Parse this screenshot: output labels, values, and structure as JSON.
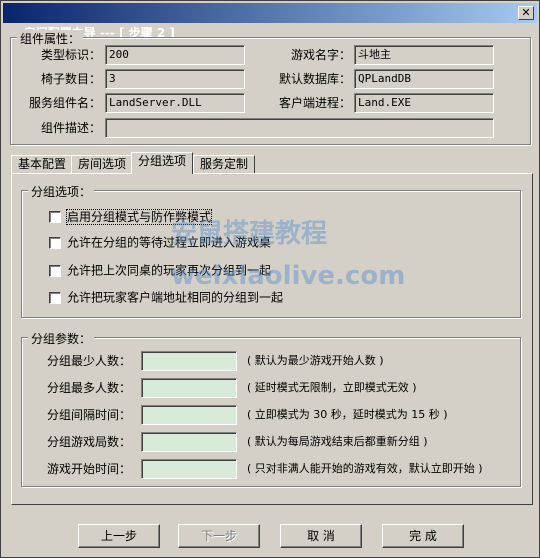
{
  "window": {
    "title": "房间配置向导 --- [ 步骤 2 ]",
    "close_glyph": "✕"
  },
  "component_group": {
    "title": "组件属性：",
    "fields": [
      {
        "label": "类型标识：",
        "value": "200"
      },
      {
        "label": "游戏名字：",
        "value": "斗地主"
      },
      {
        "label": "椅子数目：",
        "value": "3"
      },
      {
        "label": "默认数据库：",
        "value": "QPLandDB"
      },
      {
        "label": "服务组件名：",
        "value": "LandServer.DLL"
      },
      {
        "label": "客户端进程：",
        "value": "Land.EXE"
      },
      {
        "label": "组件描述：",
        "value": ""
      }
    ]
  },
  "tabs": [
    {
      "label": "基本配置"
    },
    {
      "label": "房间选项"
    },
    {
      "label": "分组选项"
    },
    {
      "label": "服务定制"
    }
  ],
  "group_options": {
    "title": "分组选项：",
    "items": [
      {
        "label": "启用分组模式与防作弊模式"
      },
      {
        "label": "允许在分组的等待过程立即进入游戏桌"
      },
      {
        "label": "允许把上次同桌的玩家再次分组到一起"
      },
      {
        "label": "允许把玩家客户端地址相同的分组到一起"
      }
    ]
  },
  "group_params": {
    "title": "分组参数：",
    "rows": [
      {
        "label": "分组最少人数：",
        "value": "",
        "hint": "( 默认为最少游戏开始人数 )"
      },
      {
        "label": "分组最多人数：",
        "value": "",
        "hint": "( 延时模式无限制，立即模式无效 )"
      },
      {
        "label": "分组间隔时间：",
        "value": "",
        "hint": "( 立即模式为 30 秒，延时模式为 15 秒 )"
      },
      {
        "label": "分组游戏局数：",
        "value": "",
        "hint": "( 默认为每局游戏结束后都重新分组 )"
      },
      {
        "label": "游戏开始时间：",
        "value": "",
        "hint": "( 只对非满人能开始的游戏有效，默认立即开始 )"
      }
    ]
  },
  "buttons": {
    "prev": "上一步",
    "next": "下一步",
    "cancel": "取 消",
    "finish": "完 成"
  },
  "watermark": {
    "line1": "安鼠搭建教程",
    "line2": "weixiaolive.com"
  }
}
